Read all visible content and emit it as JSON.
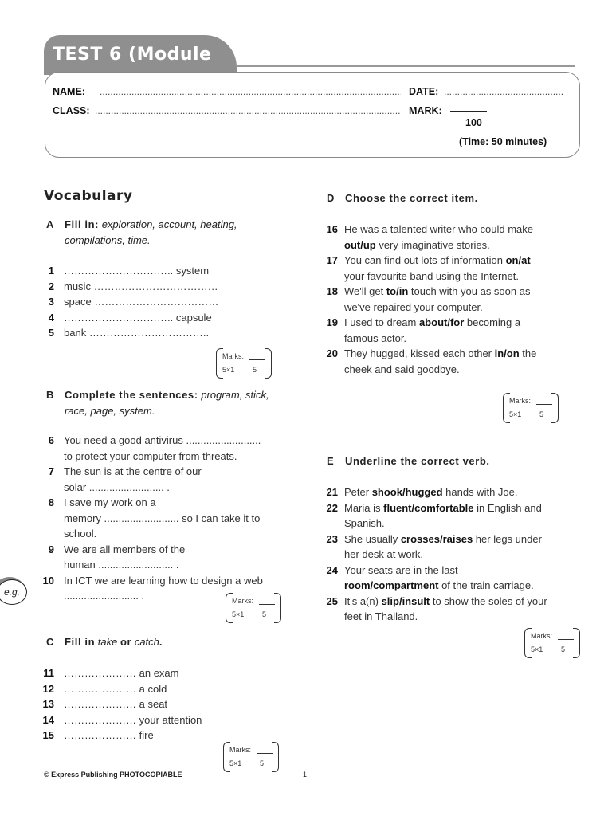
{
  "header": {
    "title": "TEST 6  (Module",
    "name_label": "NAME:",
    "class_label": "CLASS:",
    "date_label": "DATE:",
    "mark_label": "MARK:",
    "mark_total": "100",
    "time": "(Time: 50 minutes)"
  },
  "vocabulary_heading": "Vocabulary",
  "section_a": {
    "letter": "A",
    "instruction": "Fill in:",
    "words": "exploration, account, heating, compilations, time.",
    "items": [
      {
        "num": "1",
        "before": "",
        "after": "system"
      },
      {
        "num": "2",
        "before": "music",
        "after": ""
      },
      {
        "num": "3",
        "before": "space",
        "after": ""
      },
      {
        "num": "4",
        "before": "",
        "after": "capsule"
      },
      {
        "num": "5",
        "before": "bank",
        "after": ""
      }
    ]
  },
  "section_b": {
    "letter": "B",
    "instruction": "Complete the sentences:",
    "words": "program, stick, race, page, system.",
    "items": [
      {
        "num": "6",
        "lines": [
          "You need a good antivirus ..........................",
          "to protect your computer from threats."
        ]
      },
      {
        "num": "7",
        "lines": [
          "The sun is at the centre of our",
          "solar .......................... ."
        ]
      },
      {
        "num": "8",
        "lines": [
          "I save my work on a",
          "memory .......................... so I can take it to",
          "school."
        ]
      },
      {
        "num": "9",
        "lines": [
          "We are all members of the",
          "human .......................... ."
        ]
      },
      {
        "num": "10",
        "lines": [
          "In ICT we are learning how to design a web",
          ".......................... ."
        ]
      }
    ]
  },
  "section_c": {
    "letter": "C",
    "instruction_1": "Fill in",
    "option_1": "take",
    "instruction_or": "or",
    "option_2": "catch",
    "items": [
      {
        "num": "11",
        "after": "an exam"
      },
      {
        "num": "12",
        "after": "a cold"
      },
      {
        "num": "13",
        "after": "a seat"
      },
      {
        "num": "14",
        "after": "your attention"
      },
      {
        "num": "15",
        "after": "fire"
      }
    ]
  },
  "section_d": {
    "letter": "D",
    "instruction": "Choose the correct item.",
    "items": [
      {
        "num": "16",
        "l1": "He was a talented writer who could make",
        "choice": "out/up",
        "l2": " very imaginative stories."
      },
      {
        "num": "17",
        "l1": "You can find out lots of information ",
        "choice": "on/at",
        "l2": "your favourite band using the Internet."
      },
      {
        "num": "18",
        "l1pre": "We'll get ",
        "choice": "to/in",
        "l1post": " touch with you as soon as",
        "l2": "we've repaired your computer."
      },
      {
        "num": "19",
        "l1pre": "I used to dream ",
        "choice": "about/for",
        "l1post": " becoming a",
        "l2": "famous actor."
      },
      {
        "num": "20",
        "l1pre": "They hugged, kissed each other ",
        "choice": "in/on",
        "l1post": " the",
        "l2": "cheek and said goodbye."
      }
    ]
  },
  "section_e": {
    "letter": "E",
    "instruction": "Underline the correct verb.",
    "items": [
      {
        "num": "21",
        "pre": "Peter ",
        "choice": "shook/hugged",
        "post": " hands with Joe.",
        "l2": ""
      },
      {
        "num": "22",
        "pre": "Maria is ",
        "choice": "fluent/comfortable",
        "post": " in English and",
        "l2": "Spanish."
      },
      {
        "num": "23",
        "pre": "She usually ",
        "choice": "crosses/raises",
        "post": " her legs under",
        "l2": "her desk at work."
      },
      {
        "num": "24",
        "pre": "Your seats are in the last",
        "choice": "room/compartment",
        "post": " of the train carriage.",
        "l2": ""
      },
      {
        "num": "25",
        "pre": "It's a(n) ",
        "choice": "slip/insult",
        "post": " to show the soles of your",
        "l2": "feet in Thailand."
      }
    ]
  },
  "marks": {
    "label": "Marks:",
    "scale": "5×1",
    "total": "5"
  },
  "eg_badge": "e.g.",
  "footer": {
    "copyright": "© Express Publishing PHOTOCOPIABLE",
    "page": "1"
  }
}
